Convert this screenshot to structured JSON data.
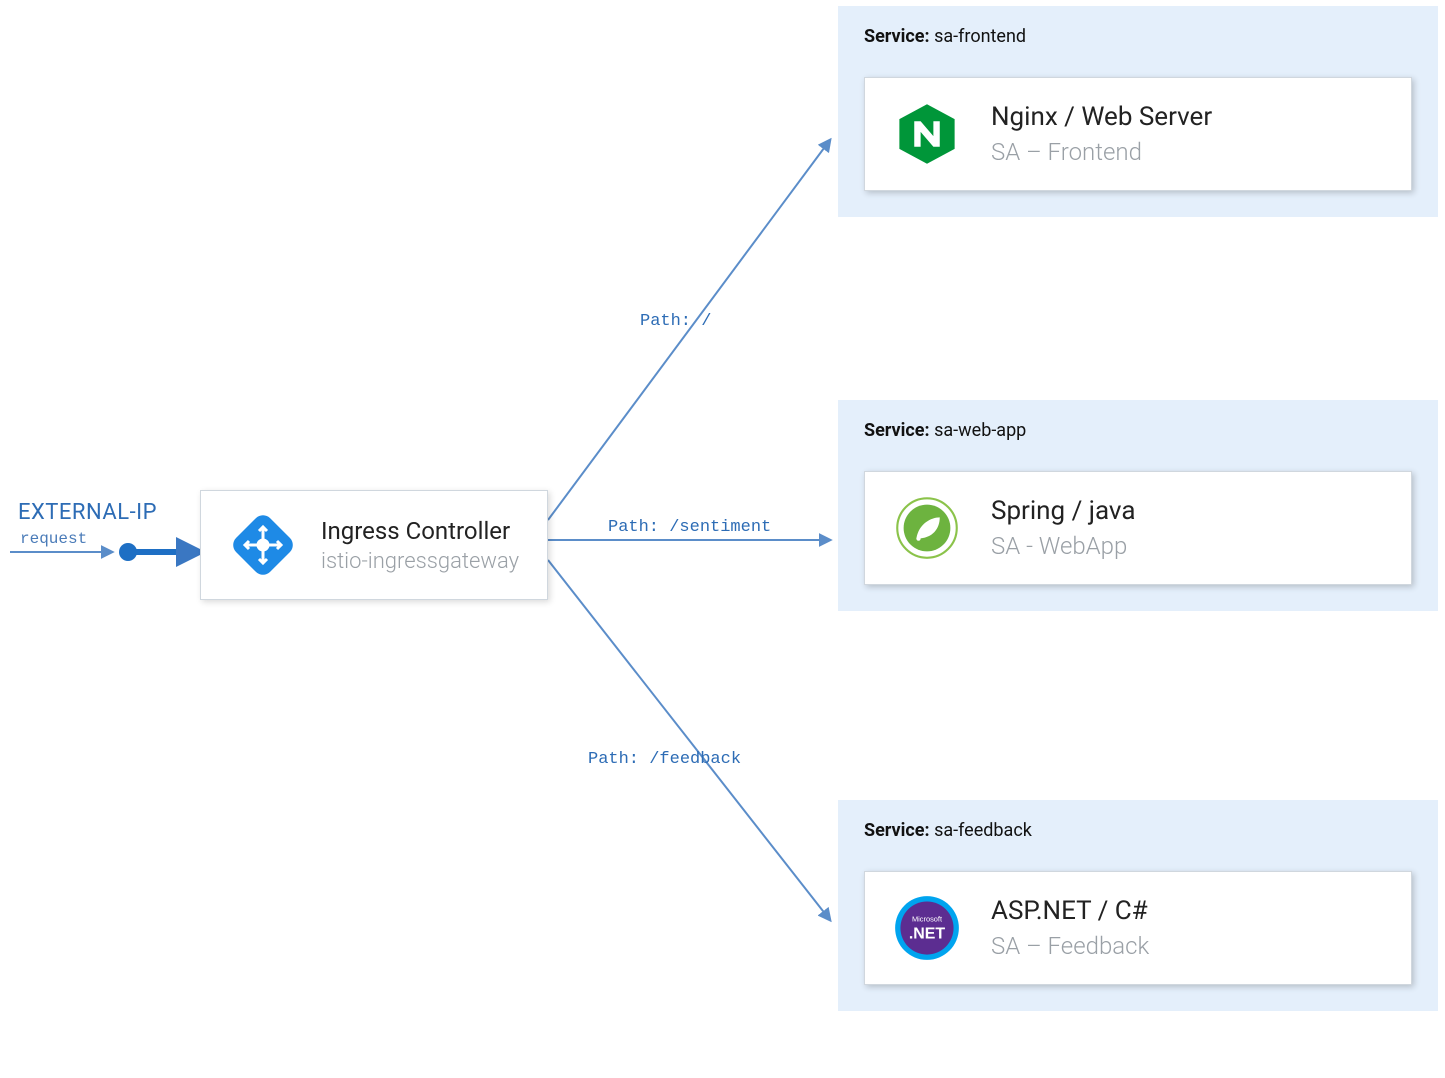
{
  "external": {
    "label": "EXTERNAL-IP",
    "request": "request"
  },
  "ingress": {
    "title": "Ingress Controller",
    "subtitle": "istio-ingressgateway"
  },
  "paths": {
    "root": "Path: /",
    "sentiment": "Path: /sentiment",
    "feedback": "Path: /feedback"
  },
  "services_header_label": "Service:",
  "services": [
    {
      "name": "sa-frontend",
      "card_title": "Nginx / Web Server",
      "card_subtitle": "SA – Frontend",
      "icon": "nginx"
    },
    {
      "name": "sa-web-app",
      "card_title": "Spring / java",
      "card_subtitle": "SA - WebApp",
      "icon": "spring"
    },
    {
      "name": "sa-feedback",
      "card_title": "ASP.NET / C#",
      "card_subtitle": "SA – Feedback",
      "icon": "dotnet"
    }
  ],
  "colors": {
    "blue": "#2d6cb5",
    "panel": "#e4effb",
    "nginx": "#009639",
    "spring": "#6db33f",
    "dotnet": "#5c2d91",
    "dotnet_ring": "#00a4ef"
  }
}
